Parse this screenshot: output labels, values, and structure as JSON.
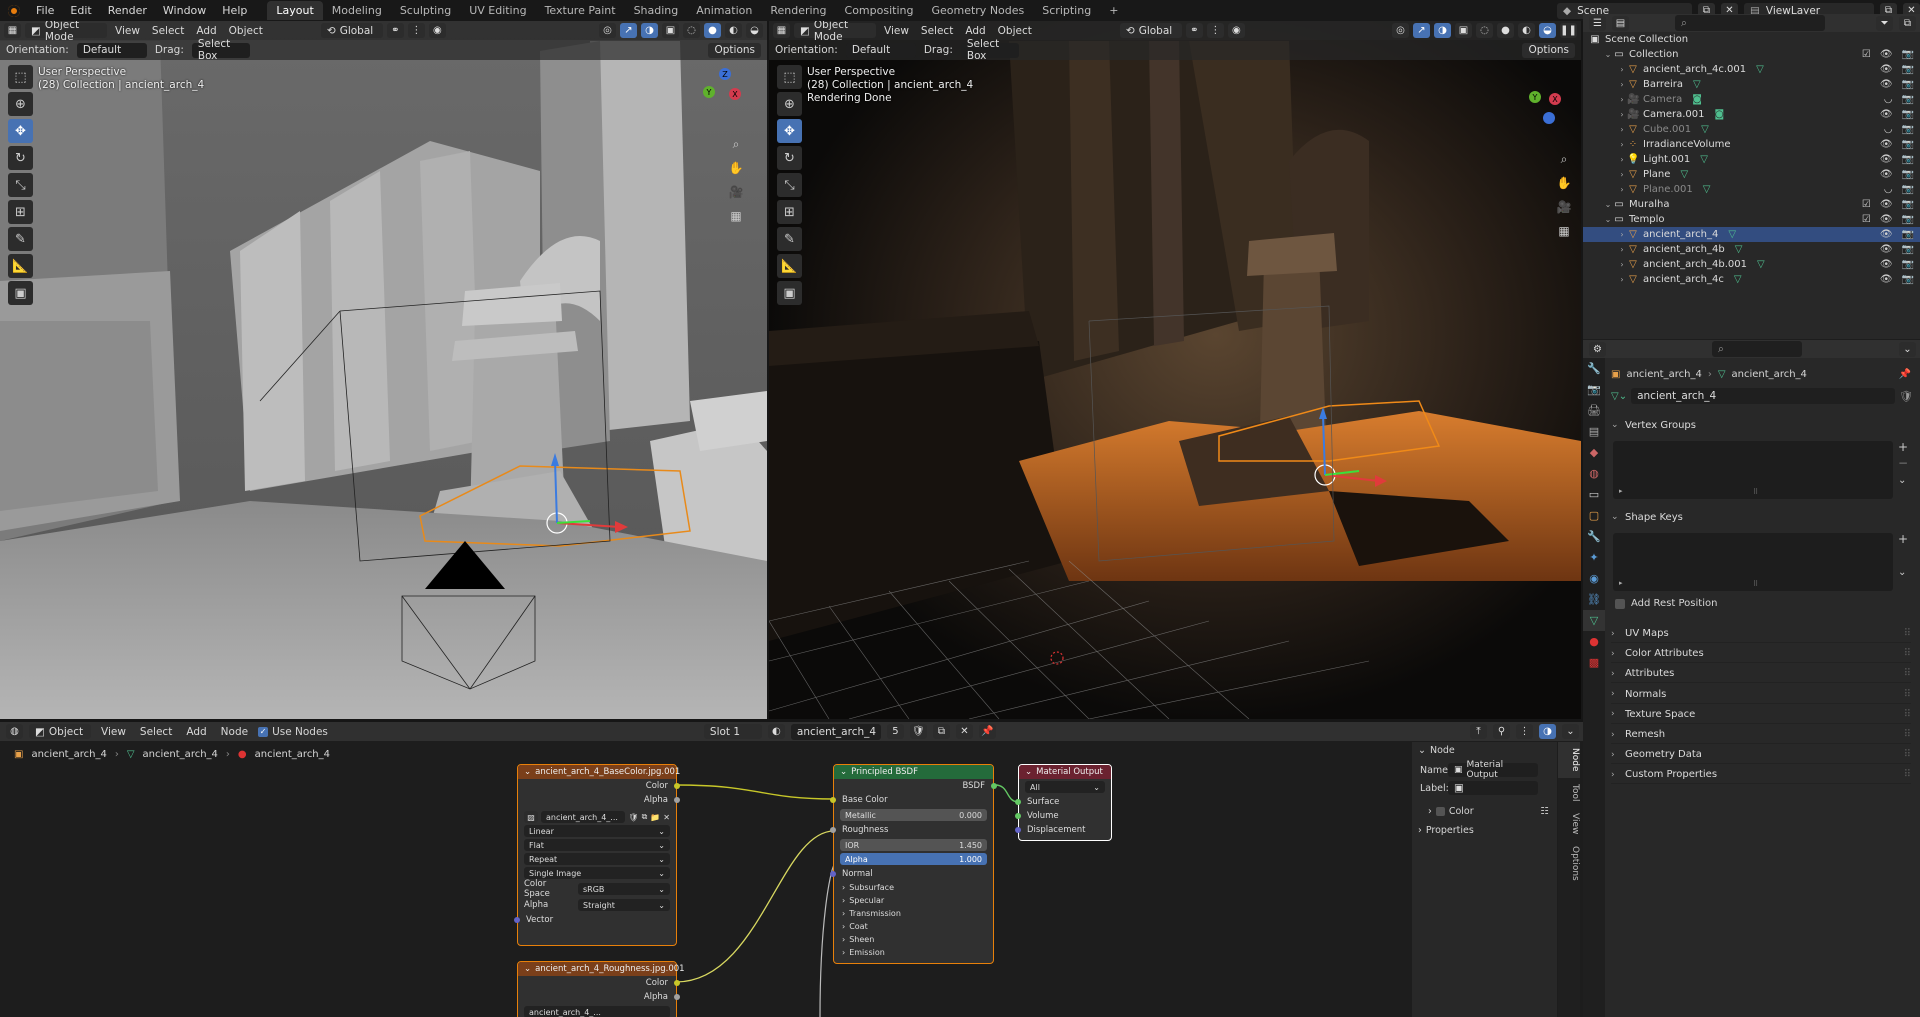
{
  "top_menu": [
    "File",
    "Edit",
    "Render",
    "Window",
    "Help"
  ],
  "workspaces": [
    "Layout",
    "Modeling",
    "Sculpting",
    "UV Editing",
    "Texture Paint",
    "Shading",
    "Animation",
    "Rendering",
    "Compositing",
    "Geometry Nodes",
    "Scripting"
  ],
  "active_workspace": "Layout",
  "scene_name": "Scene",
  "view_layer": "ViewLayer",
  "viewport_left": {
    "mode": "Object Mode",
    "menus": [
      "View",
      "Select",
      "Add",
      "Object"
    ],
    "transform": "Global",
    "orientation_label": "Orientation:",
    "orientation_value": "Default",
    "drag_label": "Drag:",
    "drag_value": "Select Box",
    "options": "Options",
    "info_line1": "User Perspective",
    "info_line2": "(28) Collection | ancient_arch_4"
  },
  "viewport_right": {
    "mode": "Object Mode",
    "menus": [
      "View",
      "Select",
      "Add",
      "Object"
    ],
    "transform": "Global",
    "orientation_label": "Orientation:",
    "orientation_value": "Default",
    "drag_label": "Drag:",
    "drag_value": "Select Box",
    "options": "Options",
    "info_line1": "User Perspective",
    "info_line2": "(28) Collection | ancient_arch_4",
    "info_line3": "Rendering Done"
  },
  "outliner": {
    "rows": [
      {
        "label": "Scene Collection",
        "indent": 0,
        "kind": "scene"
      },
      {
        "label": "Collection",
        "indent": 1,
        "kind": "collection"
      },
      {
        "label": "ancient_arch_4c.001",
        "indent": 2,
        "kind": "mesh"
      },
      {
        "label": "Barreira",
        "indent": 2,
        "kind": "mesh"
      },
      {
        "label": "Camera",
        "indent": 2,
        "kind": "camera",
        "dim": true
      },
      {
        "label": "Camera.001",
        "indent": 2,
        "kind": "camera"
      },
      {
        "label": "Cube.001",
        "indent": 2,
        "kind": "mesh",
        "dim": true
      },
      {
        "label": "IrradianceVolume",
        "indent": 2,
        "kind": "probe"
      },
      {
        "label": "Light.001",
        "indent": 2,
        "kind": "light"
      },
      {
        "label": "Plane",
        "indent": 2,
        "kind": "mesh"
      },
      {
        "label": "Plane.001",
        "indent": 2,
        "kind": "mesh",
        "dim": true
      },
      {
        "label": "Muralha",
        "indent": 1,
        "kind": "collection"
      },
      {
        "label": "Templo",
        "indent": 1,
        "kind": "collection"
      },
      {
        "label": "ancient_arch_4",
        "indent": 2,
        "kind": "mesh",
        "selected": true
      },
      {
        "label": "ancient_arch_4b",
        "indent": 2,
        "kind": "mesh"
      },
      {
        "label": "ancient_arch_4b.001",
        "indent": 2,
        "kind": "mesh"
      },
      {
        "label": "ancient_arch_4c",
        "indent": 2,
        "kind": "mesh"
      }
    ]
  },
  "properties": {
    "breadcrumb_object": "ancient_arch_4",
    "breadcrumb_data": "ancient_arch_4",
    "mesh_name": "ancient_arch_4",
    "panels": [
      "Vertex Groups",
      "Shape Keys"
    ],
    "add_rest_position": "Add Rest Position",
    "collapsed_panels": [
      "UV Maps",
      "Color Attributes",
      "Attributes",
      "Normals",
      "Texture Space",
      "Remesh",
      "Geometry Data",
      "Custom Properties"
    ]
  },
  "node_editor": {
    "editor_type": "Object",
    "menus": [
      "View",
      "Select",
      "Add",
      "Node"
    ],
    "use_nodes": "Use Nodes",
    "slot": "Slot 1",
    "material": "ancient_arch_4",
    "users": "5",
    "breadcrumb": [
      "ancient_arch_4",
      "ancient_arch_4",
      "ancient_arch_4"
    ],
    "image_node_1": {
      "title": "ancient_arch_4_BaseColor.jpg.001",
      "outputs": [
        "Color",
        "Alpha"
      ],
      "image_name": "ancient_arch_4_...",
      "interpolation": "Linear",
      "projection": "Flat",
      "extension": "Repeat",
      "source": "Single Image",
      "color_space_label": "Color Space",
      "color_space": "sRGB",
      "alpha_label": "Alpha",
      "alpha_mode": "Straight",
      "input": "Vector"
    },
    "image_node_2": {
      "title": "ancient_arch_4_Roughness.jpg.001",
      "outputs": [
        "Color",
        "Alpha"
      ],
      "image_name": "ancient_arch_4_..."
    },
    "bsdf": {
      "title": "Principled BSDF",
      "output": "BSDF",
      "base_color": "Base Color",
      "metallic_label": "Metallic",
      "metallic": "0.000",
      "roughness": "Roughness",
      "ior_label": "IOR",
      "ior": "1.450",
      "alpha_label": "Alpha",
      "alpha": "1.000",
      "normal": "Normal",
      "subpanels": [
        "Subsurface",
        "Specular",
        "Transmission",
        "Coat",
        "Sheen",
        "Emission"
      ]
    },
    "material_output": {
      "title": "Material Output",
      "target": "All",
      "inputs": [
        "Surface",
        "Volume",
        "Displacement"
      ]
    },
    "sidebar": {
      "section": "Node",
      "name_label": "Name:",
      "name_value": "Material Output",
      "label_label": "Label:",
      "color": "Color",
      "properties": "Properties",
      "tabs": [
        "Node",
        "Tool",
        "View",
        "Options"
      ]
    }
  }
}
